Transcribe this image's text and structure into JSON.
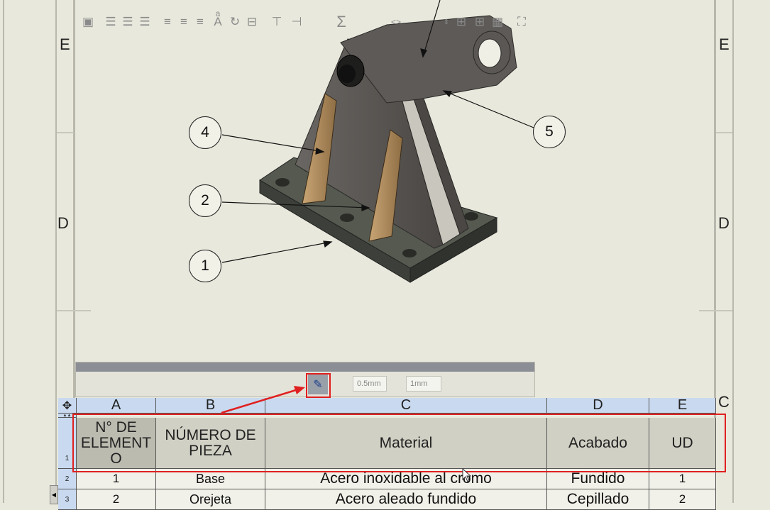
{
  "zones": {
    "left_top": "E",
    "right_top": "E",
    "left_mid": "D",
    "right_mid": "D",
    "right_bottom": "C"
  },
  "balloons": [
    "4",
    "2",
    "1",
    "5"
  ],
  "toolbar": {
    "thickness_value": "0.5mm",
    "spacing_value": "1mm",
    "sum_symbol": "Σ"
  },
  "table": {
    "columns": [
      "A",
      "B",
      "C",
      "D",
      "E"
    ],
    "header": {
      "row_number": "1",
      "cells": [
        "N° DE ELEMENT O",
        "NÚMERO DE PIEZA",
        "Material",
        "Acabado",
        "UD"
      ]
    },
    "rows": [
      {
        "row_number": "2",
        "cells": [
          "1",
          "Base",
          "Acero inoxidable al cromo",
          "Fundido",
          "1"
        ]
      },
      {
        "row_number": "3",
        "cells": [
          "2",
          "Orejeta",
          "Acero aleado fundido",
          "Cepillado",
          "2"
        ]
      }
    ]
  },
  "colors": {
    "highlight": "#e02020",
    "column_header_bg": "#c9daf0",
    "header_row_bg": "#d1d0c4"
  }
}
